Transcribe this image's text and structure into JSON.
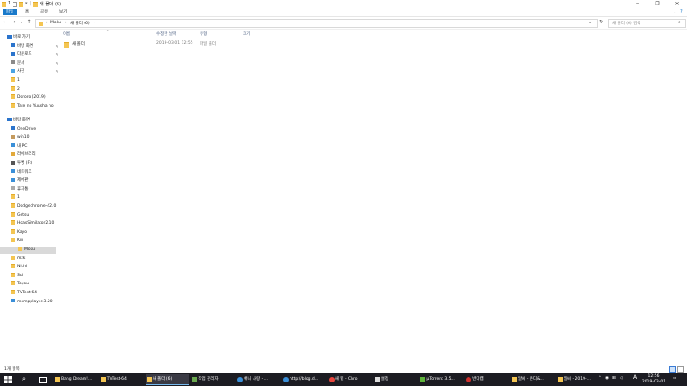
{
  "window": {
    "quick_access_number": "1",
    "title": "새 폴더 (6)",
    "minimize": "─",
    "maximize": "❐",
    "close": "✕"
  },
  "ribbon": {
    "tabs": [
      "파일",
      "홈",
      "공유",
      "보기"
    ]
  },
  "address": {
    "sep": "›",
    "path": [
      "Moku",
      "새 폴더 (6)"
    ],
    "search_placeholder": "새 폴더 (6) 검색"
  },
  "nav": {
    "quick_access": "바로 가기",
    "quick_items": [
      {
        "label": "바탕 화면",
        "icon": "desktop-icon",
        "pinned": true
      },
      {
        "label": "다운로드",
        "icon": "download-icon",
        "pinned": true
      },
      {
        "label": "문서",
        "icon": "document-icon",
        "pinned": true
      },
      {
        "label": "사진",
        "icon": "picture-icon",
        "pinned": true
      },
      {
        "label": "1",
        "icon": "folder-icon"
      },
      {
        "label": "2",
        "icon": "folder-icon"
      },
      {
        "label": "Dororo (2019)",
        "icon": "folder-icon"
      },
      {
        "label": "Tate no Yuusha no",
        "icon": "folder-icon"
      }
    ],
    "desktop": "바탕 화면",
    "desktop_items": [
      {
        "label": "OneDrive",
        "icon": "onedrive-icon"
      },
      {
        "label": "win10",
        "icon": "user-icon"
      },
      {
        "label": "내 PC",
        "icon": "pc-icon"
      },
      {
        "label": "라이브러리",
        "icon": "library-icon"
      },
      {
        "label": "투명 (F:)",
        "icon": "drive-icon"
      },
      {
        "label": "네트워크",
        "icon": "network-icon"
      },
      {
        "label": "제어판",
        "icon": "control-panel-icon"
      },
      {
        "label": "휴지통",
        "icon": "recycle-bin-icon"
      },
      {
        "label": "1",
        "icon": "folder-icon"
      },
      {
        "label": "Dodgechrome-42.0",
        "icon": "folder-icon"
      },
      {
        "label": "Getsu",
        "icon": "folder-icon"
      },
      {
        "label": "HoasSimilator2.10",
        "icon": "folder-icon"
      },
      {
        "label": "Kayo",
        "icon": "folder-icon"
      },
      {
        "label": "Kin",
        "icon": "folder-icon"
      },
      {
        "label": "Moku",
        "icon": "folder-icon",
        "selected": true
      },
      {
        "label": "mzk",
        "icon": "folder-icon"
      },
      {
        "label": "Nichi",
        "icon": "folder-icon"
      },
      {
        "label": "Sui",
        "icon": "folder-icon"
      },
      {
        "label": "Toyou",
        "icon": "folder-icon"
      },
      {
        "label": "TVTest-64",
        "icon": "folder-icon"
      },
      {
        "label": "mompplayer.3.20",
        "icon": "app-icon"
      }
    ]
  },
  "content": {
    "columns": [
      "이름",
      "수정한 날짜",
      "유형",
      "크기"
    ],
    "files": [
      {
        "name": "새 폴더",
        "date": "2019-03-01 12:55",
        "type": "파일 폴더",
        "size": ""
      }
    ]
  },
  "status": {
    "count": "1개 항목"
  },
  "taskbar": {
    "apps": [
      {
        "label": "Bang Dream!...",
        "icon": "folder-icon"
      },
      {
        "label": "TVTest-64",
        "icon": "folder-icon"
      },
      {
        "label": "새 폴더 (6)",
        "icon": "folder-icon",
        "active": true
      },
      {
        "label": "작업 관리자",
        "icon": "task-manager-icon"
      },
      {
        "label": "애니 사랑 - ...",
        "icon": "ie-icon"
      },
      {
        "label": "http://blog.d...",
        "icon": "ie-icon"
      },
      {
        "label": "새 탭 - Chro",
        "icon": "chrome-icon"
      },
      {
        "label": "설정",
        "icon": "gear-icon"
      },
      {
        "label": "µTorrent 3.5...",
        "icon": "utorrent-icon"
      },
      {
        "label": "반디캠",
        "icon": "bandicam-icon"
      },
      {
        "label": "알씨 - 온디&...",
        "icon": "alsee-icon"
      },
      {
        "label": "알씨 - 2019-...",
        "icon": "alsee-icon"
      }
    ],
    "ime": "A",
    "time": "12:56",
    "date": "2019-03-01"
  },
  "colors": {
    "accent": "#1979ca",
    "folder": "#f4c552",
    "taskbar": "#1c1c22"
  }
}
